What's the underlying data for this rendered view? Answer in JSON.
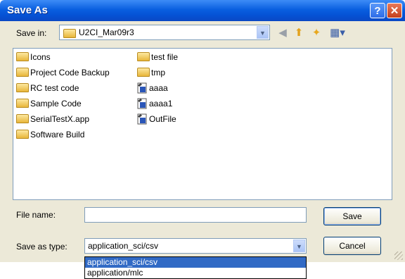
{
  "window": {
    "title": "Save As",
    "help_glyph": "?",
    "close_glyph": "✕"
  },
  "save_in": {
    "label": "Save in:",
    "value": "U2CI_Mar09r3",
    "dropdown_glyph": "⌄"
  },
  "toolbar": {
    "back_icon": "back-arrow-icon",
    "up_icon": "up-folder-icon",
    "new_folder_icon": "new-folder-icon",
    "view_icon": "view-menu-icon"
  },
  "files": [
    {
      "name": "Icons",
      "type": "folder"
    },
    {
      "name": "Project Code Backup",
      "type": "folder"
    },
    {
      "name": "RC test code",
      "type": "folder"
    },
    {
      "name": "Sample Code",
      "type": "folder"
    },
    {
      "name": "SerialTestX.app",
      "type": "folder"
    },
    {
      "name": "Software Build",
      "type": "folder"
    },
    {
      "name": "test file",
      "type": "folder"
    },
    {
      "name": "tmp",
      "type": "folder"
    },
    {
      "name": "aaaa",
      "type": "file"
    },
    {
      "name": "aaaa1",
      "type": "file"
    },
    {
      "name": "OutFile",
      "type": "file"
    }
  ],
  "file_name": {
    "label": "File name:",
    "value": ""
  },
  "save_as_type": {
    "label": "Save as type:",
    "value": "application_sci/csv",
    "options": [
      "application_sci/csv",
      "application/mlc"
    ]
  },
  "buttons": {
    "save": "Save",
    "cancel": "Cancel"
  },
  "colors": {
    "title_bar": "#0a5fe0",
    "dialog_bg": "#ece9d8",
    "selection": "#316ac5"
  }
}
